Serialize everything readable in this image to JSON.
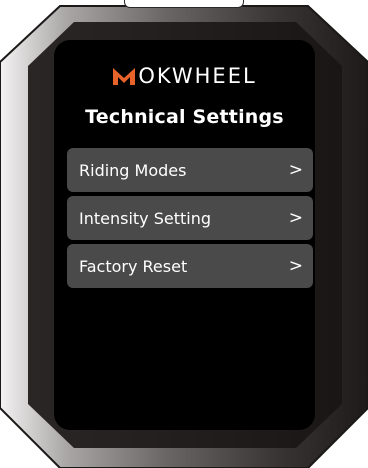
{
  "device": {
    "brand": "MOKWHEEL",
    "brand_rest": "OKWHEEL",
    "accent_color": "#e8632a"
  },
  "screen": {
    "title": "Technical Settings"
  },
  "menu": {
    "items": [
      {
        "label": "Riding Modes",
        "chevron": ">"
      },
      {
        "label": "Intensity Setting",
        "chevron": ">"
      },
      {
        "label": "Factory Reset",
        "chevron": ">"
      }
    ]
  }
}
